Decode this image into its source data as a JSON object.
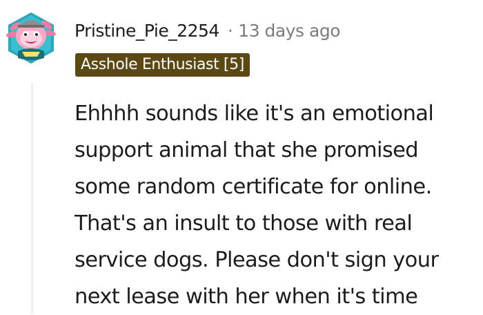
{
  "comment": {
    "author": {
      "username": "Pristine_Pie_2254",
      "avatar_icon": "axolotl-avatar-icon"
    },
    "separator": "·",
    "timestamp": "13 days ago",
    "flair": {
      "label": "Asshole Enthusiast [5]",
      "color": "#5c4813"
    },
    "body_lines": [
      "Ehhhh sounds like it's an emotional",
      "support animal that she promised",
      "some random certificate for online.",
      "That's an insult to those with real",
      "service dogs. Please don't sign your",
      "next lease with her when it's time"
    ]
  },
  "colors": {
    "text": "#1c1c1c",
    "muted": "#7c7c7c",
    "thread_line": "#edeff1",
    "flair_bg": "#5c4813"
  }
}
